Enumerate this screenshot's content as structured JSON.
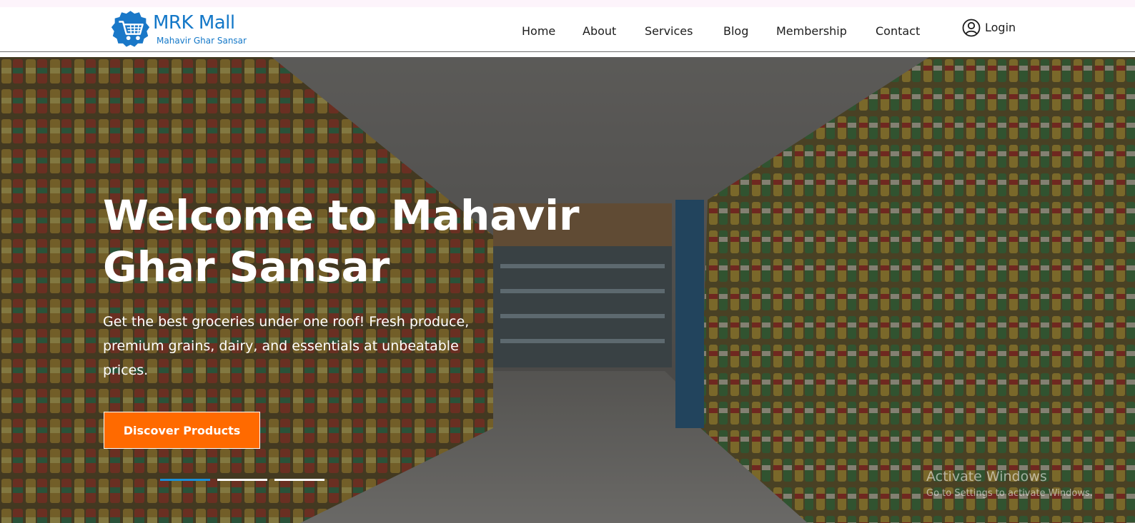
{
  "brand": {
    "name": "MRK Mall",
    "tagline": "Mahavir Ghar Sansar",
    "logo_icon": "shopping-cart-badge-icon",
    "color": "#1478c8"
  },
  "nav": {
    "items": [
      {
        "label": "Home"
      },
      {
        "label": "About"
      },
      {
        "label": "Services"
      },
      {
        "label": "Blog"
      },
      {
        "label": "Membership"
      },
      {
        "label": "Contact"
      }
    ],
    "login": {
      "label": "Login",
      "icon": "user-circle-icon"
    }
  },
  "hero": {
    "title_lines": [
      "Welcome to Mahavir",
      "Ghar Sansar"
    ],
    "description_lines": [
      "Get the best groceries under one roof! Fresh produce,",
      "premium grains, dairy, and essentials at unbeatable",
      "prices."
    ],
    "cta_label": "Discover Products",
    "cta_color": "#ff6a00",
    "background": "supermarket-aisle-photo",
    "slides": {
      "count": 3,
      "active_index": 0
    },
    "slide_indicator_active_color": "#1b8fd6"
  },
  "os_watermark": {
    "title": "Activate Windows",
    "subtitle": "Go to Settings to activate Windows."
  }
}
